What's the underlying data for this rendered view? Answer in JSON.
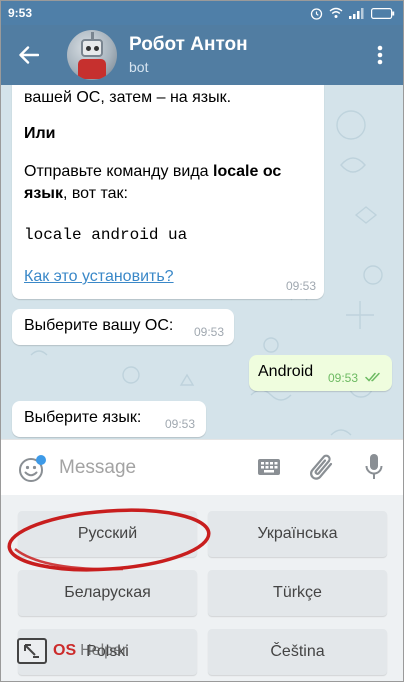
{
  "status_bar": {
    "time": "9:53",
    "icons": [
      "alarm-icon",
      "wifi-icon",
      "signal-icon",
      "battery-icon"
    ]
  },
  "header": {
    "title": "Робот Антон",
    "subtitle": "bot",
    "back_icon": "arrow-left-icon",
    "menu_icon": "more-vertical-icon"
  },
  "messages": {
    "instructions": {
      "line1": "вашей ОС, затем – на язык.",
      "line2": "Или",
      "line3_prefix": "Отправьте команду вида ",
      "line3_bold": "locale ос",
      "line4_bold": "язык",
      "line4_rest": ", вот так:",
      "code": "locale android ua",
      "link": "Как это установить?",
      "time": "09:53"
    },
    "choose_os": {
      "text": "Выберите вашу ОС:",
      "time": "09:53"
    },
    "android": {
      "text": "Android",
      "time": "09:53",
      "status": "read"
    },
    "choose_lang": {
      "text": "Выберите язык:",
      "time": "09:53"
    }
  },
  "input_bar": {
    "placeholder": "Message",
    "icons": [
      "emoji-icon",
      "keyboard-icon",
      "attach-icon",
      "microphone-icon"
    ]
  },
  "bot_keyboard": {
    "buttons": [
      "Русский",
      "Українська",
      "Беларуская",
      "Türkçe",
      "Polski",
      "Čeština"
    ]
  },
  "watermark": {
    "brand": "OS",
    "name": "Helper"
  },
  "colors": {
    "header": "#517da2",
    "chat_bg": "#d4e3ea",
    "outgoing_bubble": "#effdde",
    "link": "#3a88c8",
    "highlight": "#c81e1e",
    "unread_dot": "#3d9ae8"
  }
}
